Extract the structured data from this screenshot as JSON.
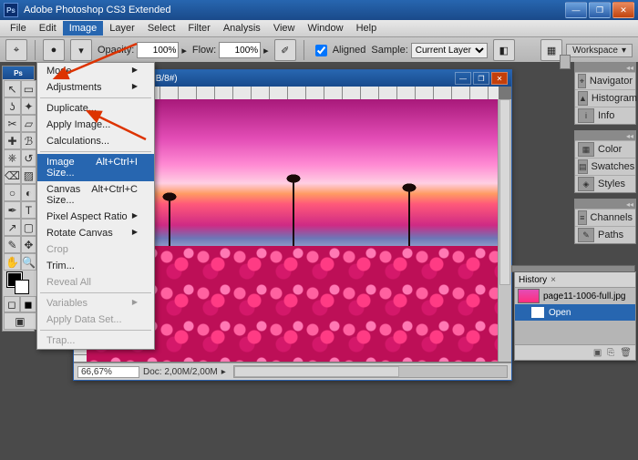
{
  "titlebar": {
    "icon": "Ps",
    "title": "Adobe Photoshop CS3 Extended"
  },
  "menubar": {
    "items": [
      "File",
      "Edit",
      "Image",
      "Layer",
      "Select",
      "Filter",
      "Analysis",
      "View",
      "Window",
      "Help"
    ],
    "active_index": 2
  },
  "optbar": {
    "opacity_label": "Opacity:",
    "opacity_value": "100%",
    "flow_label": "Flow:",
    "flow_value": "100%",
    "aligned_label": "Aligned",
    "sample_label": "Sample:",
    "sample_value": "Current Layer",
    "workspace_label": "Workspace"
  },
  "image_menu": {
    "items": [
      {
        "label": "Mode",
        "sub": true
      },
      {
        "label": "Adjustments",
        "sub": true
      },
      {
        "sep": true
      },
      {
        "label": "Duplicate..."
      },
      {
        "label": "Apply Image..."
      },
      {
        "label": "Calculations..."
      },
      {
        "sep": true
      },
      {
        "label": "Image Size...",
        "shortcut": "Alt+Ctrl+I",
        "highlight": true
      },
      {
        "label": "Canvas Size...",
        "shortcut": "Alt+Ctrl+C"
      },
      {
        "label": "Pixel Aspect Ratio",
        "sub": true
      },
      {
        "label": "Rotate Canvas",
        "sub": true
      },
      {
        "label": "Crop",
        "disabled": true
      },
      {
        "label": "Trim..."
      },
      {
        "label": "Reveal All",
        "disabled": true
      },
      {
        "sep": true
      },
      {
        "label": "Variables",
        "sub": true,
        "disabled": true
      },
      {
        "label": "Apply Data Set...",
        "disabled": true
      },
      {
        "sep": true
      },
      {
        "label": "Trap...",
        "disabled": true
      }
    ]
  },
  "doc": {
    "title": "ll.jpg @ 66,7% (RGB/8#)",
    "zoom": "66,67%",
    "info": "Doc: 2,00M/2,00M"
  },
  "dock": {
    "group1": [
      "Navigator",
      "Histogram",
      "Info"
    ],
    "group2": [
      "Color",
      "Swatches",
      "Styles"
    ],
    "group3": [
      "Channels",
      "Paths"
    ]
  },
  "history": {
    "tab": "History",
    "doc_name": "page11-1006-full.jpg",
    "state": "Open"
  },
  "toolbox": {
    "title": "Ps"
  }
}
